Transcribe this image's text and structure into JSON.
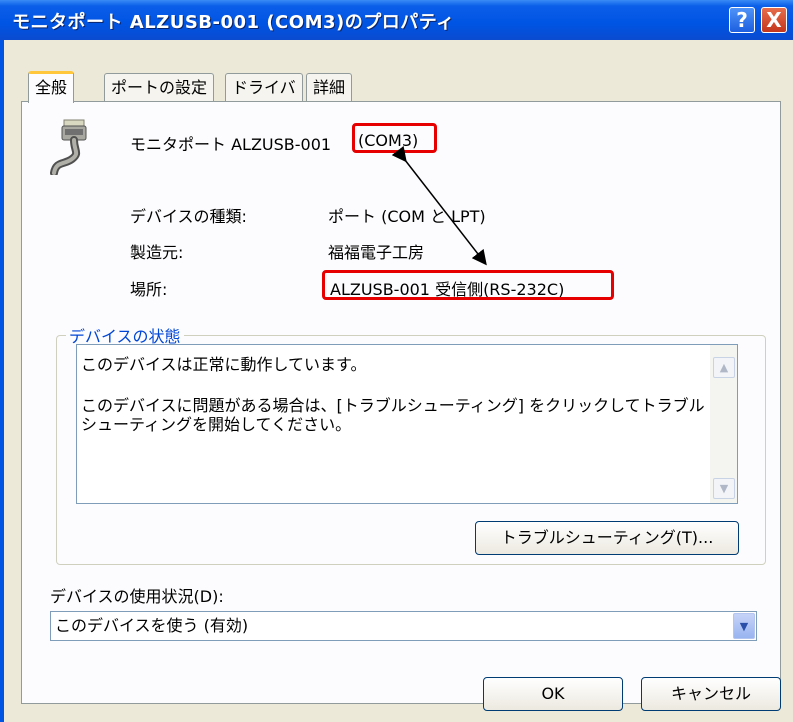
{
  "title": "モニタポート ALZUSB-001 (COM3)のプロパティ",
  "titlebar_buttons": {
    "help": "?",
    "close": "X"
  },
  "tabs": [
    "全般",
    "ポートの設定",
    "ドライバ",
    "詳細"
  ],
  "device": {
    "name_prefix": "モニタポート ALZUSB-001 ",
    "name_highlight": "(COM3)"
  },
  "props": {
    "type_label": "デバイスの種類:",
    "type_value": "ポート (COM と LPT)",
    "maker_label": "製造元:",
    "maker_value": "福福電子工房",
    "location_label": "場所:",
    "location_value": "ALZUSB-001 受信側(RS-232C)"
  },
  "status": {
    "group_label": "デバイスの状態",
    "line1": "このデバイスは正常に動作しています。",
    "line2": "このデバイスに問題がある場合は、[トラブルシューティング] をクリックしてトラブル",
    "line3": "シューティングを開始してください。"
  },
  "troubleshoot_button": "トラブルシューティング(T)...",
  "usage": {
    "label": "デバイスの使用状況(D):",
    "value": "このデバイスを使う (有効)"
  },
  "buttons": {
    "ok": "OK",
    "cancel": "キャンセル"
  },
  "colors": {
    "titlebar": "#0054e3",
    "highlight_box": "#e60000",
    "group_label": "#0046d5"
  },
  "icons": [
    "serial-port-icon",
    "help-icon",
    "close-icon",
    "scroll-up-icon",
    "scroll-down-icon",
    "dropdown-arrow-icon",
    "double-arrow-icon"
  ]
}
